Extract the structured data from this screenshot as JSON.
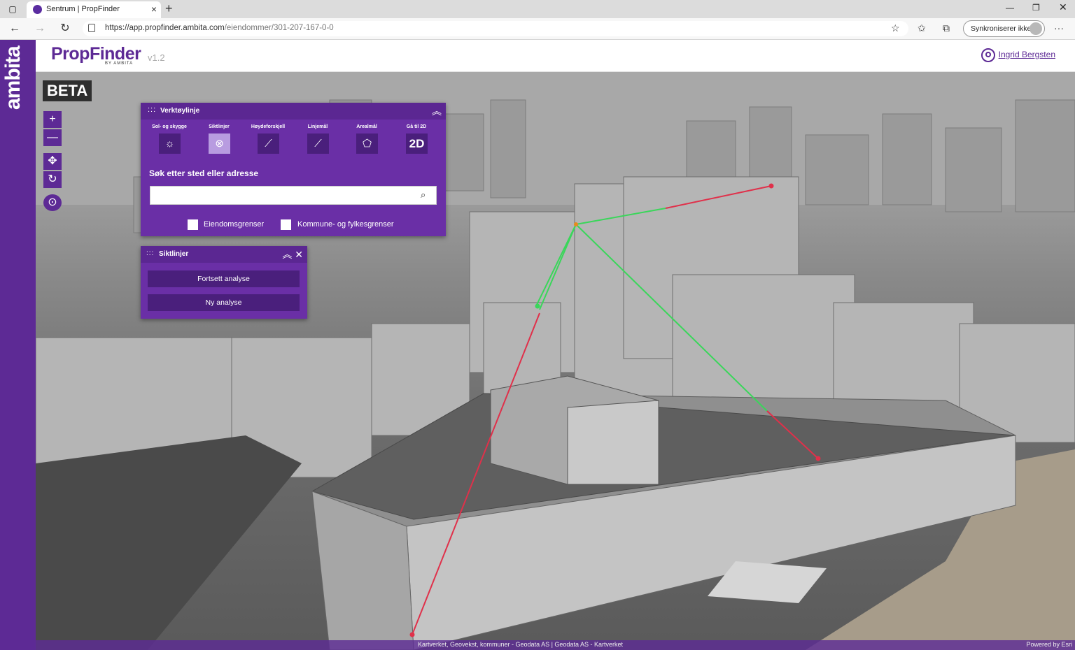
{
  "browser": {
    "tab_title": "Sentrum | PropFinder",
    "url_host": "https://app.propfinder.ambita.com",
    "url_path": "/eiendommer/301-207-167-0-0",
    "sync_label": "Synkroniserer ikke",
    "more_icon": "···"
  },
  "sidebar": {
    "brand": "ambita"
  },
  "header": {
    "logo": "PropFinder",
    "logo_sub": "BY AMBITA",
    "version": "v1.2",
    "user_name": "Ingrid Bergsten"
  },
  "map": {
    "beta_label": "BETA",
    "controls": [
      "+",
      "—",
      "✥",
      "↻",
      "⊙"
    ],
    "attribution": "Kartverket, Geovekst, kommuner - Geodata AS | Geodata AS - Kartverket",
    "powered_by": "Powered by Esri"
  },
  "toolbar": {
    "title": "Verktøylinje",
    "tools": [
      {
        "label": "Sol- og skygge",
        "icon": "sun-icon"
      },
      {
        "label": "Siktlinjer",
        "icon": "sightline-icon",
        "active": true
      },
      {
        "label": "Høydeforskjell",
        "icon": "chart-line-icon"
      },
      {
        "label": "Linjemål",
        "icon": "line-measure-icon"
      },
      {
        "label": "Arealmål",
        "icon": "area-measure-icon"
      },
      {
        "label": "Gå til 2D",
        "icon": "2d-icon",
        "text": "2D"
      }
    ],
    "search_label": "Søk etter sted eller adresse",
    "search_value": "",
    "checkbox_property": "Eiendomsgrenser",
    "checkbox_municipality": "Kommune- og fylkesgrenser"
  },
  "sightlines": {
    "title": "Siktlinjer",
    "continue_label": "Fortsett analyse",
    "new_label": "Ny analyse"
  },
  "colors": {
    "brand": "#5d2a95",
    "panel": "#6a2fa6",
    "visible_line": "#3ad65a",
    "blocked_line": "#e0304a"
  }
}
